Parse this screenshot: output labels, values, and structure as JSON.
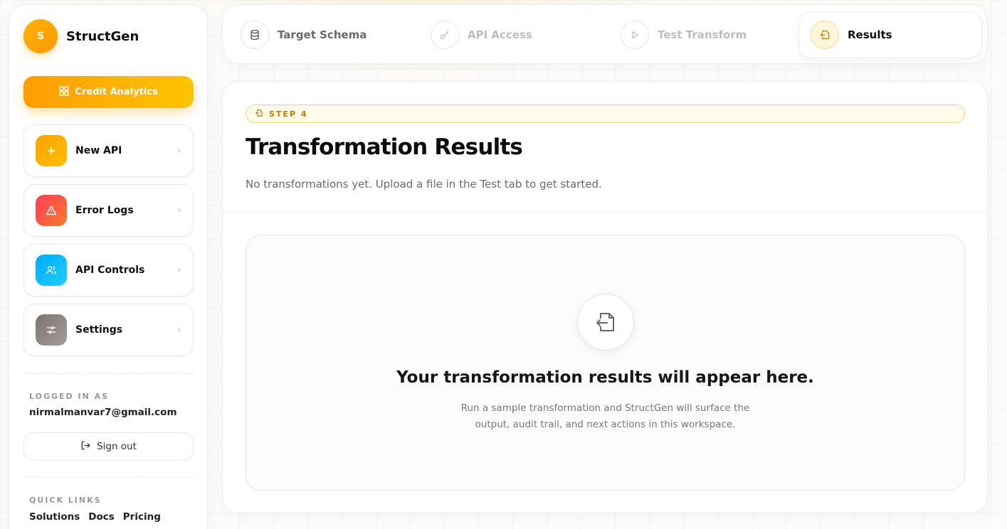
{
  "brand": {
    "logo_letter": "S",
    "name": "StructGen"
  },
  "credit_button": {
    "label": "Credit Analytics"
  },
  "nav": [
    {
      "label": "New API",
      "icon": "plus-icon",
      "color": "#ffa800"
    },
    {
      "label": "Error Logs",
      "icon": "warning-icon",
      "color": "#ff4d4d"
    },
    {
      "label": "API Controls",
      "icon": "users-icon",
      "color": "#12b5ff"
    },
    {
      "label": "Settings",
      "icon": "sliders-icon",
      "color": "#8a8380"
    }
  ],
  "account": {
    "label": "LOGGED IN AS",
    "email": "nirmalmanvar7@gmail.com",
    "signout_label": "Sign out"
  },
  "quick_links": {
    "label": "QUICK LINKS",
    "items": [
      "Solutions",
      "Docs",
      "Pricing"
    ]
  },
  "steps": [
    {
      "label": "Target Schema",
      "icon": "database-icon",
      "state": "completed"
    },
    {
      "label": "API Access",
      "icon": "key-icon",
      "state": "pending"
    },
    {
      "label": "Test Transform",
      "icon": "play-icon",
      "state": "pending"
    },
    {
      "label": "Results",
      "icon": "file-import-icon",
      "state": "active"
    }
  ],
  "main": {
    "badge": "STEP 4",
    "title": "Transformation Results",
    "subtitle": "No transformations yet. Upload a file in the Test tab to get started.",
    "empty_title": "Your transformation results will appear here.",
    "empty_desc_line1": "Run a sample transformation and StructGen will surface the",
    "empty_desc_line2": "output, audit trail, and next actions in this workspace."
  },
  "colors": {
    "accent": "#ffa800",
    "accent_light": "#ffc300",
    "badge_text": "#c07a00"
  }
}
